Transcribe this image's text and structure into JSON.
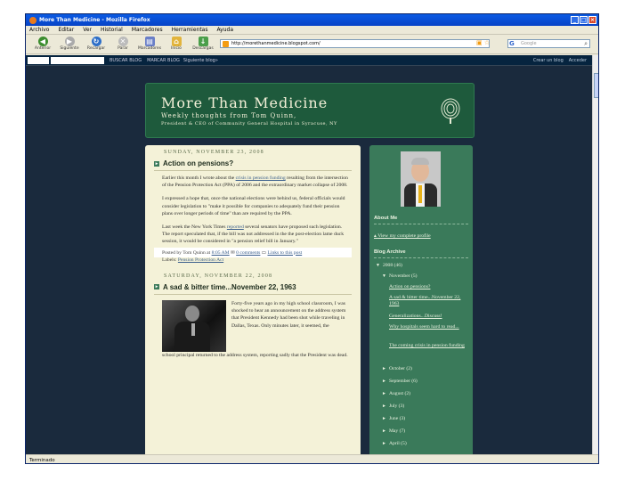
{
  "window": {
    "title": "More Than Medicine - Mozilla Firefox"
  },
  "menu": [
    "Archivo",
    "Editar",
    "Ver",
    "Historial",
    "Marcadores",
    "Herramientas",
    "Ayuda"
  ],
  "nav": {
    "back": "Anterior",
    "forward": "Siguiente",
    "reload": "Recargar",
    "stop": "Parar",
    "bookmarks": "Marcadores",
    "home": "Inicio",
    "downloads": "Descargas",
    "url": "http://morethanmedicine.blogspot.com/",
    "search_placeholder": "Google"
  },
  "bloggerbar": {
    "search_blog": "BUSCAR BLOG",
    "flag": "MARCAR BLOG",
    "next_blog": "Siguiente blog»",
    "create": "Crear un blog",
    "sign_in": "Acceder"
  },
  "header": {
    "title": "More Than Medicine",
    "subtitle": "Weekly thoughts from Tom Quinn,",
    "subtitle2": "President & CEO of Community General Hospital in Syracuse, NY"
  },
  "post1": {
    "date": "SUNDAY, NOVEMBER 23, 2008",
    "title": "Action on pensions?",
    "p1_pre": "Earlier this month I wrote about the",
    "p1_link": "crisis in pension funding",
    "p1_post": "resulting from the intersection of the Pension Protection Act (PPA) of 2006 and the extraordinary market collapse of 2008.",
    "p2": "I expressed a hope that, once the national elections were behind us, federal officials would consider legislation to \"make it possible for companies to adequately fund their pension plans over longer periods of time\" than are required by the PPA.",
    "p3_pre": "Last week the New York Times",
    "p3_link": "reported",
    "p3_post": "several senators have proposed such legislation. The report speculated that, if the bill was not addressed in the the post-election lame duck session, it would be considered in \"a pension relief bill in January.\"",
    "posted_by": "Posted by Tom Quinn at",
    "time": "8:05 AM",
    "comments": "0 comments",
    "links": "Links to this post",
    "labels_label": "Labels:",
    "label1": "Pension Protection Act"
  },
  "post2": {
    "date": "SATURDAY, NOVEMBER 22, 2008",
    "title": "A sad & bitter time...November 22, 1963",
    "text_right": "Forty-five years ago in my high school classroom, I was shocked to hear an announcement on the address system that President Kennedy had been shot while traveling in Dallas, Texas. Only minutes later, it seemed, the",
    "text_bottom": "school principal returned to the address system, reporting sadly that the President was dead."
  },
  "sidebar": {
    "about_title": "About Me",
    "profile_link": "View my complete profile",
    "archive_title": "Blog Archive",
    "year": "2008 (46)",
    "month": "November (5)",
    "posts": [
      "Action on pensions?",
      "A sad & bitter time...November 22, 1963",
      "Generalizations...Discuss!",
      "Why hospitals seem hard to read...",
      "The coming crisis in pension funding"
    ],
    "months": [
      "October (2)",
      "September (6)",
      "August (2)",
      "July (3)",
      "June (3)",
      "May (7)",
      "April (5)"
    ]
  },
  "status": "Terminado"
}
